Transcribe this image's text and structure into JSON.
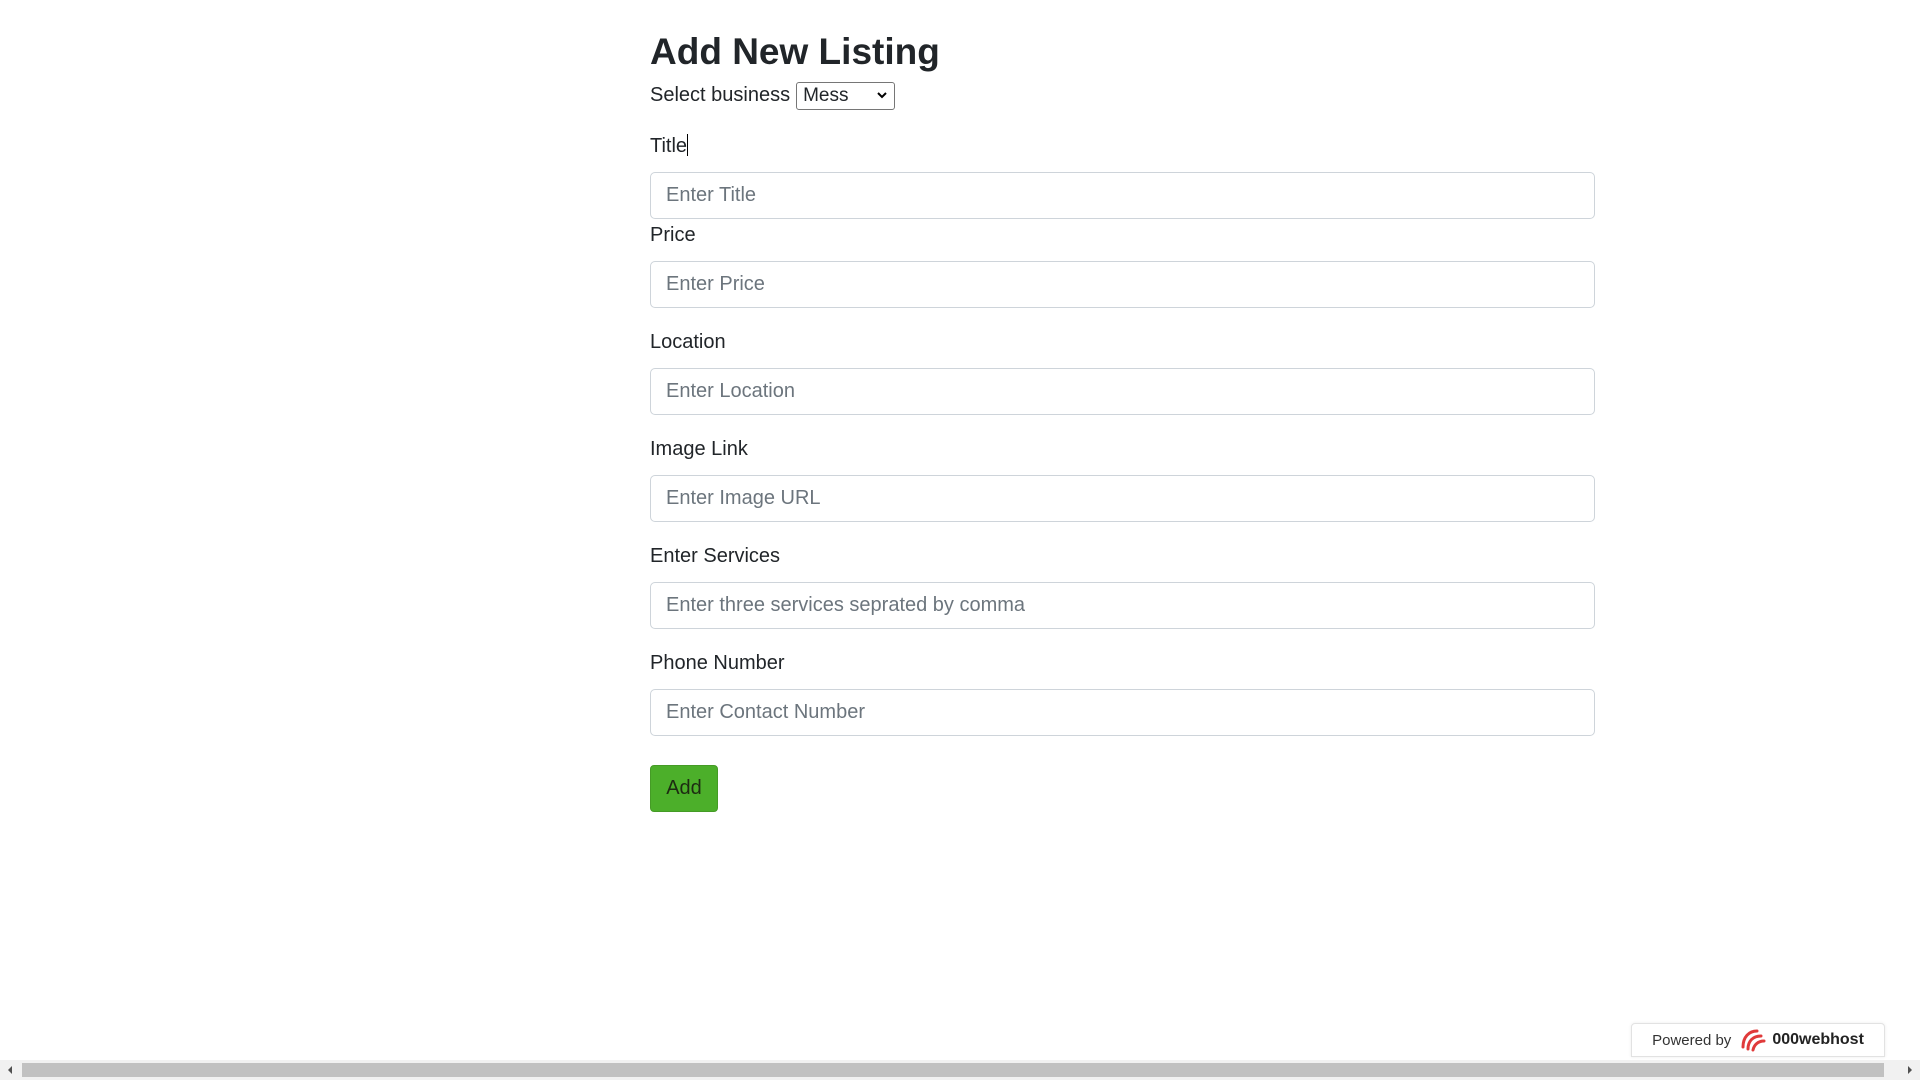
{
  "page": {
    "heading": "Add New Listing"
  },
  "business": {
    "label": "Select business",
    "selected": "Mess"
  },
  "fields": {
    "title": {
      "label": "Title",
      "placeholder": "Enter Title"
    },
    "price": {
      "label": "Price",
      "placeholder": "Enter Price"
    },
    "location": {
      "label": "Location",
      "placeholder": "Enter Location"
    },
    "image_link": {
      "label": "Image Link",
      "placeholder": "Enter Image URL"
    },
    "services": {
      "label": "Enter Services",
      "placeholder": "Enter three services seprated by comma"
    },
    "phone": {
      "label": "Phone Number",
      "placeholder": "Enter Contact Number"
    }
  },
  "actions": {
    "add_label": "Add"
  },
  "footer_badge": {
    "powered_by": "Powered by",
    "brand": "000webhost",
    "logo_icon": "000webhost-logo-icon"
  },
  "colors": {
    "add_button": "#4caf2a",
    "input_border": "#ced4da",
    "logo_red": "#e03a3a"
  }
}
